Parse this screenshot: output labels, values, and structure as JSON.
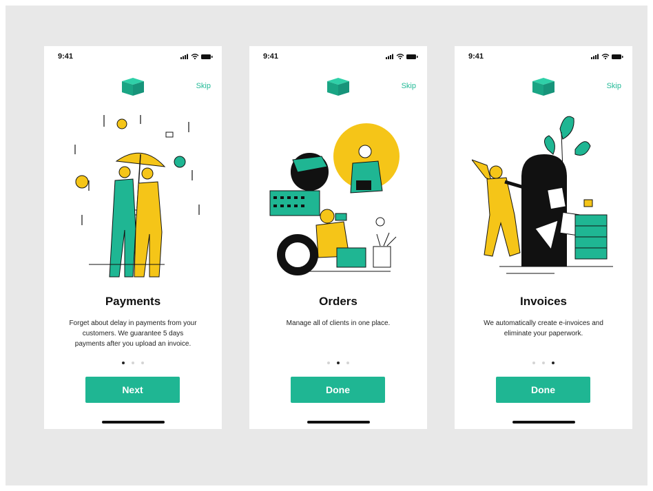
{
  "colors": {
    "background": "#e8e8e8",
    "accent": "#1fb693",
    "yellow": "#f5c518",
    "dark": "#111111"
  },
  "screens": [
    {
      "status_time": "9:41",
      "skip_label": "Skip",
      "title": "Payments",
      "description": "Forget about delay in payments from your customers. We guarantee 5 days payments after you upload an invoice.",
      "button_label": "Next",
      "active_page": 1,
      "illustration": "people-with-umbrella-and-coins"
    },
    {
      "status_time": "9:41",
      "skip_label": "Skip",
      "title": "Orders",
      "description": "Manage all of clients in one place.",
      "button_label": "Done",
      "active_page": 2,
      "illustration": "client-management-collage"
    },
    {
      "status_time": "9:41",
      "skip_label": "Skip",
      "title": "Invoices",
      "description": "We automatically create e-invoices and eliminate your paperwork.",
      "button_label": "Done",
      "active_page": 3,
      "illustration": "person-dancing-by-door-with-documents"
    }
  ],
  "page_count": 3
}
